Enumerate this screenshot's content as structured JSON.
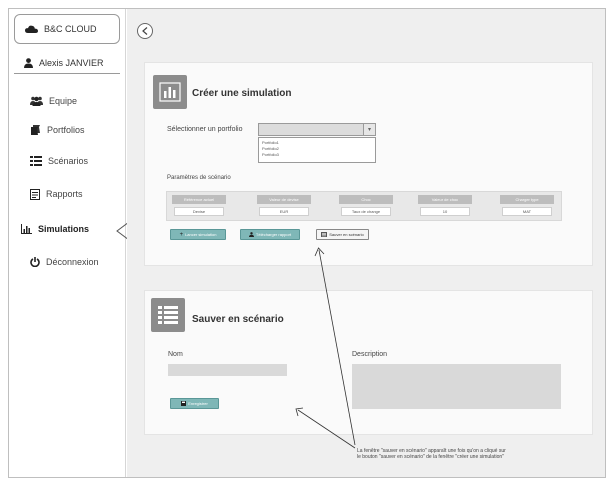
{
  "sidebar": {
    "brand": "B&C CLOUD",
    "user": "Alexis JANVIER",
    "items": [
      {
        "label": "Equipe",
        "icon": "team-icon"
      },
      {
        "label": "Portfolios",
        "icon": "briefcase-icon"
      },
      {
        "label": "Scénarios",
        "icon": "list-icon"
      },
      {
        "label": "Rapports",
        "icon": "report-icon"
      },
      {
        "label": "Simulations",
        "icon": "bar-chart-icon",
        "active": true
      },
      {
        "label": "Déconnexion",
        "icon": "power-icon"
      }
    ]
  },
  "simulation": {
    "title": "Créer une simulation",
    "portfolio_label": "Sélectionner un portfolio",
    "portfolio_options": [
      "Portfolio1",
      "Portfolio2",
      "Portfolio3"
    ],
    "params_label": "Paramètres de scénario",
    "params": [
      {
        "header": "Référence actuel",
        "value": "Devise"
      },
      {
        "header": "Valeur de devise",
        "value": "EUR"
      },
      {
        "header": "Choc",
        "value": "Taux de change"
      },
      {
        "header": "Valeur de choc",
        "value": "10"
      },
      {
        "header": "Charger type",
        "value": "MAT"
      }
    ],
    "buttons": {
      "launch": "Lancer simulation",
      "export": "Télécharger rapport",
      "save": "Sauver en scénario"
    }
  },
  "save_scenario": {
    "title": "Sauver en scénario",
    "name_label": "Nom",
    "description_label": "Description",
    "save_button": "Enregistrer"
  },
  "annotation": {
    "note": "La fenêtre \"sauver en scénario\" apparaît une fois qu'on a cliqué sur le bouton \"sauver en scénario\" de la fenêtre \"créer une simulation\""
  },
  "colors": {
    "accent_teal": "#7fb7b7",
    "icon_gray": "#8c8c8c",
    "main_bg": "#efefef"
  }
}
